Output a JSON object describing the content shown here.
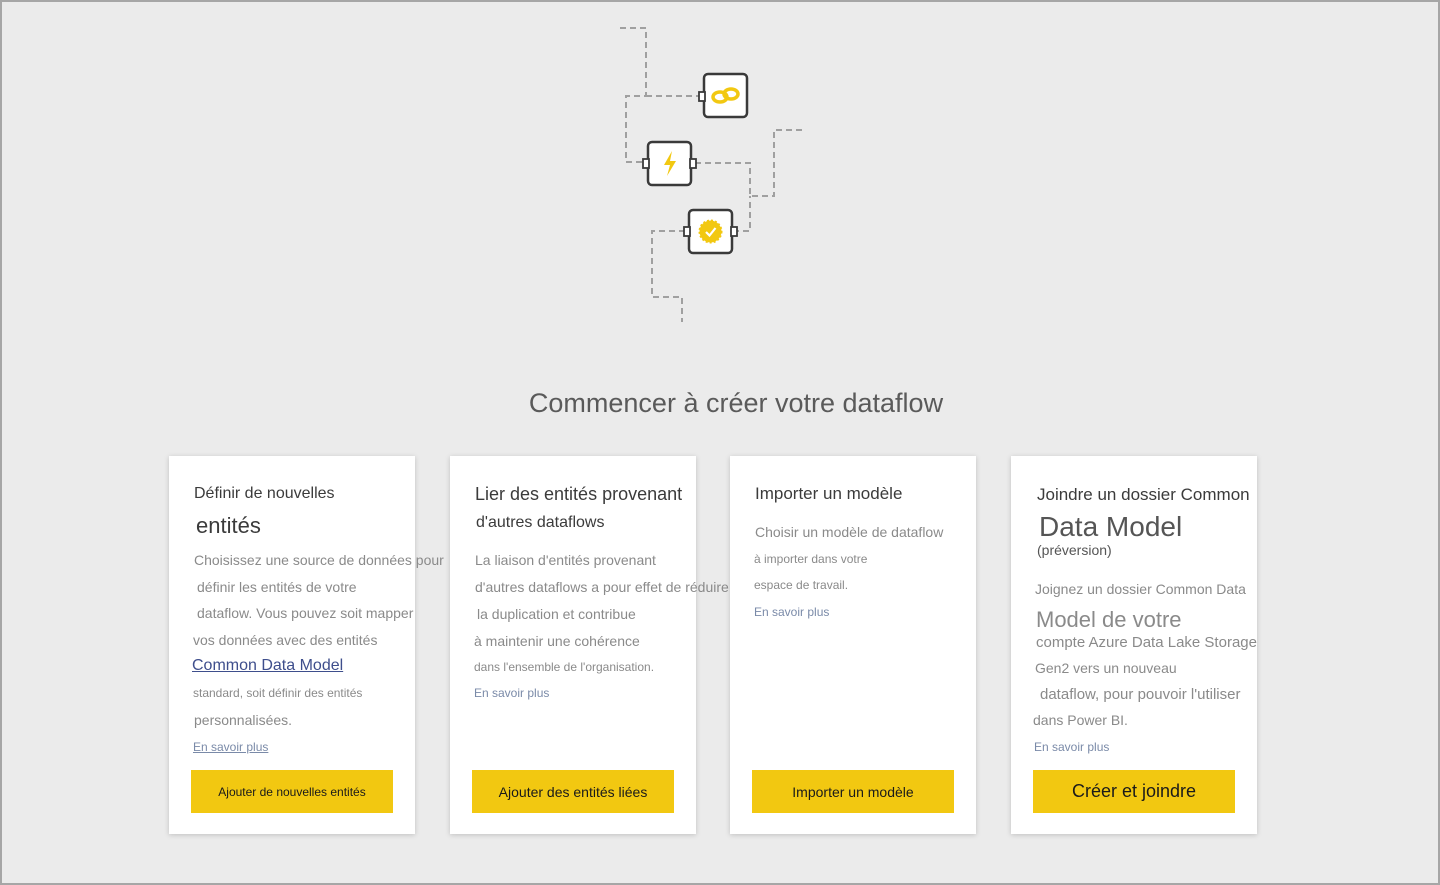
{
  "page": {
    "title": "Commencer à créer votre dataflow"
  },
  "illustration": {
    "icons": [
      "link-icon",
      "lightning-icon",
      "check-badge-icon"
    ],
    "accent_color": "#f2c811"
  },
  "cards": [
    {
      "title_lines": [
        "Définir de nouvelles",
        "entités"
      ],
      "description_lines": [
        "Choisissez une source de données pour",
        "définir les entités de votre",
        "dataflow. Vous pouvez soit mapper",
        "vos données avec des entités",
        "Common Data Model",
        "standard, soit définir des entités",
        "personnalisées."
      ],
      "learn_more": "En savoir plus",
      "button_label": "Ajouter de nouvelles entités"
    },
    {
      "title_lines": [
        "Lier des entités provenant",
        "d'autres dataflows"
      ],
      "description_lines": [
        "La liaison d'entités provenant",
        "d'autres dataflows a pour effet de réduire",
        "la duplication et contribue",
        "à maintenir une cohérence",
        "dans l'ensemble de l'organisation."
      ],
      "learn_more": "En savoir plus",
      "button_label": "Ajouter des entités liées"
    },
    {
      "title_lines": [
        "Importer un modèle"
      ],
      "description_lines": [
        "Choisir un modèle de dataflow",
        "à importer dans votre",
        "espace de travail."
      ],
      "learn_more": "En savoir plus",
      "button_label": "Importer un modèle"
    },
    {
      "title_lines": [
        "Joindre un dossier Common",
        "Data Model",
        "(préversion)"
      ],
      "description_lines": [
        "Joignez un dossier Common Data",
        "Model de votre",
        "compte Azure Data Lake Storage",
        "Gen2 vers un nouveau",
        "dataflow, pour pouvoir l'utiliser",
        "dans Power BI."
      ],
      "learn_more": "En savoir plus",
      "button_label": "Créer et joindre"
    }
  ]
}
